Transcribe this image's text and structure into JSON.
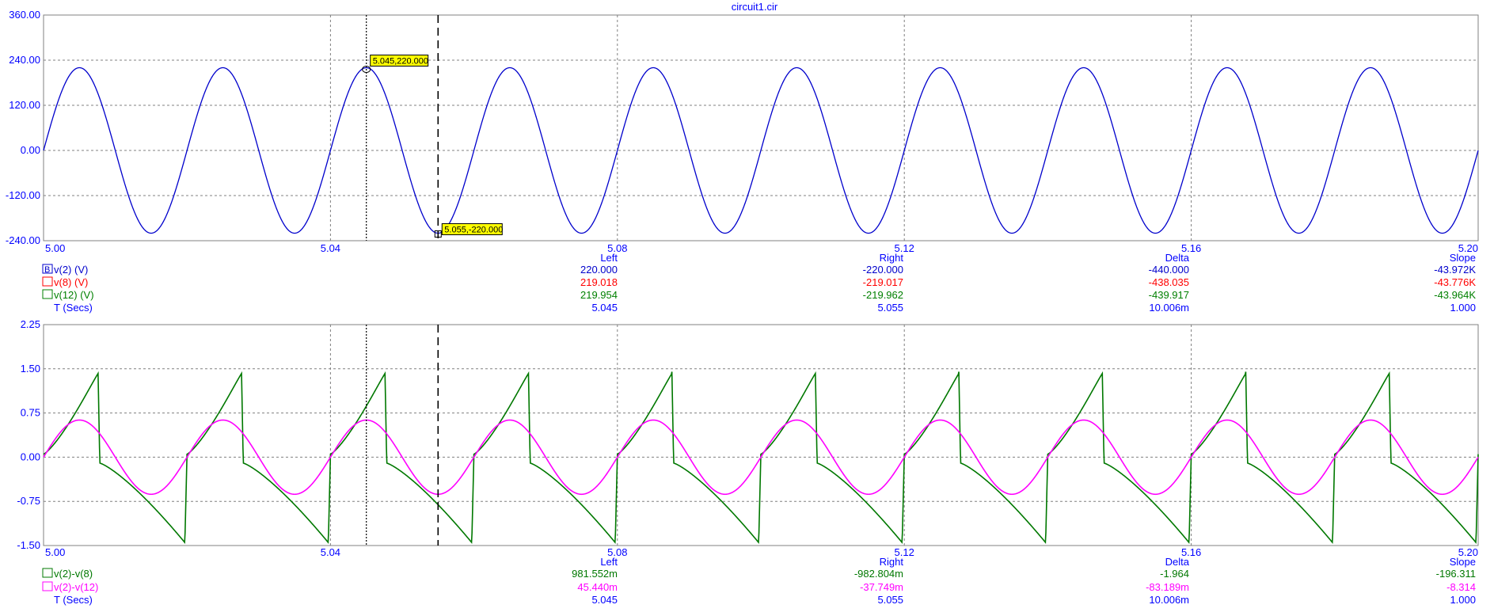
{
  "window_title": "circuit1.cir",
  "cursor_columns": [
    "Left",
    "Right",
    "Delta",
    "Slope"
  ],
  "colors": {
    "axis": "#0000ff",
    "grid": "#808080",
    "frame": "#808080",
    "cursor": "#000000",
    "tag_bg": "#ffff00",
    "v2": "#0000cc",
    "v8": "#ff0000",
    "v12": "#008000",
    "v2_v8": "#007800",
    "v2_v12": "#ff00ff"
  },
  "chart_data": [
    {
      "type": "line",
      "name": "top-plot",
      "xlim": [
        5.0,
        5.2
      ],
      "ylim": [
        -240,
        360
      ],
      "x_ticks": [
        "5.00",
        "5.04",
        "5.08",
        "5.12",
        "5.16",
        "5.20"
      ],
      "y_ticks": [
        "360.00",
        "240.00",
        "120.00",
        "0.00",
        "-120.00",
        "-240.00"
      ],
      "grid": true,
      "x_cursors": [
        5.045,
        5.055
      ],
      "cursor_tags": [
        {
          "text": "5.045,220.000",
          "x": 5.045,
          "y": 220
        },
        {
          "text": "5.055,-220.000",
          "x": 5.055,
          "y": -220
        }
      ],
      "series": [
        {
          "name": "v(2) (V)",
          "color": "#0000cc",
          "waveform": "sine",
          "amplitude": 220,
          "frequency_hz": 50,
          "visible": true,
          "marker": "B",
          "left": "220.000",
          "right": "-220.000",
          "delta": "-440.000",
          "slope": "-43.972K"
        },
        {
          "name": "v(8) (V)",
          "color": "#ff0000",
          "waveform": "sine",
          "amplitude": 219.018,
          "frequency_hz": 50,
          "visible": false,
          "marker": "",
          "left": "219.018",
          "right": "-219.017",
          "delta": "-438.035",
          "slope": "-43.776K"
        },
        {
          "name": "v(12) (V)",
          "color": "#008000",
          "waveform": "sine",
          "amplitude": 219.954,
          "frequency_hz": 50,
          "visible": false,
          "marker": "",
          "left": "219.954",
          "right": "-219.962",
          "delta": "-439.917",
          "slope": "-43.964K"
        }
      ],
      "xvar": {
        "name": "T (Secs)",
        "left": "5.045",
        "right": "5.055",
        "delta": "10.006m",
        "slope": "1.000"
      }
    },
    {
      "type": "line",
      "name": "bottom-plot",
      "xlim": [
        5.0,
        5.2
      ],
      "ylim": [
        -1.5,
        2.25
      ],
      "x_ticks": [
        "5.00",
        "5.04",
        "5.08",
        "5.12",
        "5.16",
        "5.20"
      ],
      "y_ticks": [
        "2.25",
        "1.50",
        "0.75",
        "0.00",
        "-0.75",
        "-1.50"
      ],
      "grid": true,
      "x_cursors": [
        5.045,
        5.055
      ],
      "series": [
        {
          "name": "v(2)-v(8)",
          "color": "#007800",
          "waveform": "sawtooth-like",
          "frequency_hz": 50,
          "peak": 1.45,
          "trough": -1.45,
          "visible": true,
          "left": "981.552m",
          "right": "-982.804m",
          "delta": "-1.964",
          "slope": "-196.311"
        },
        {
          "name": "v(2)-v(12)",
          "color": "#ff00ff",
          "waveform": "sine",
          "amplitude": 0.63,
          "frequency_hz": 50,
          "visible": true,
          "left": "45.440m",
          "right": "-37.749m",
          "delta": "-83.189m",
          "slope": "-8.314"
        }
      ],
      "xvar": {
        "name": "T (Secs)",
        "left": "5.045",
        "right": "5.055",
        "delta": "10.006m",
        "slope": "1.000"
      }
    }
  ]
}
